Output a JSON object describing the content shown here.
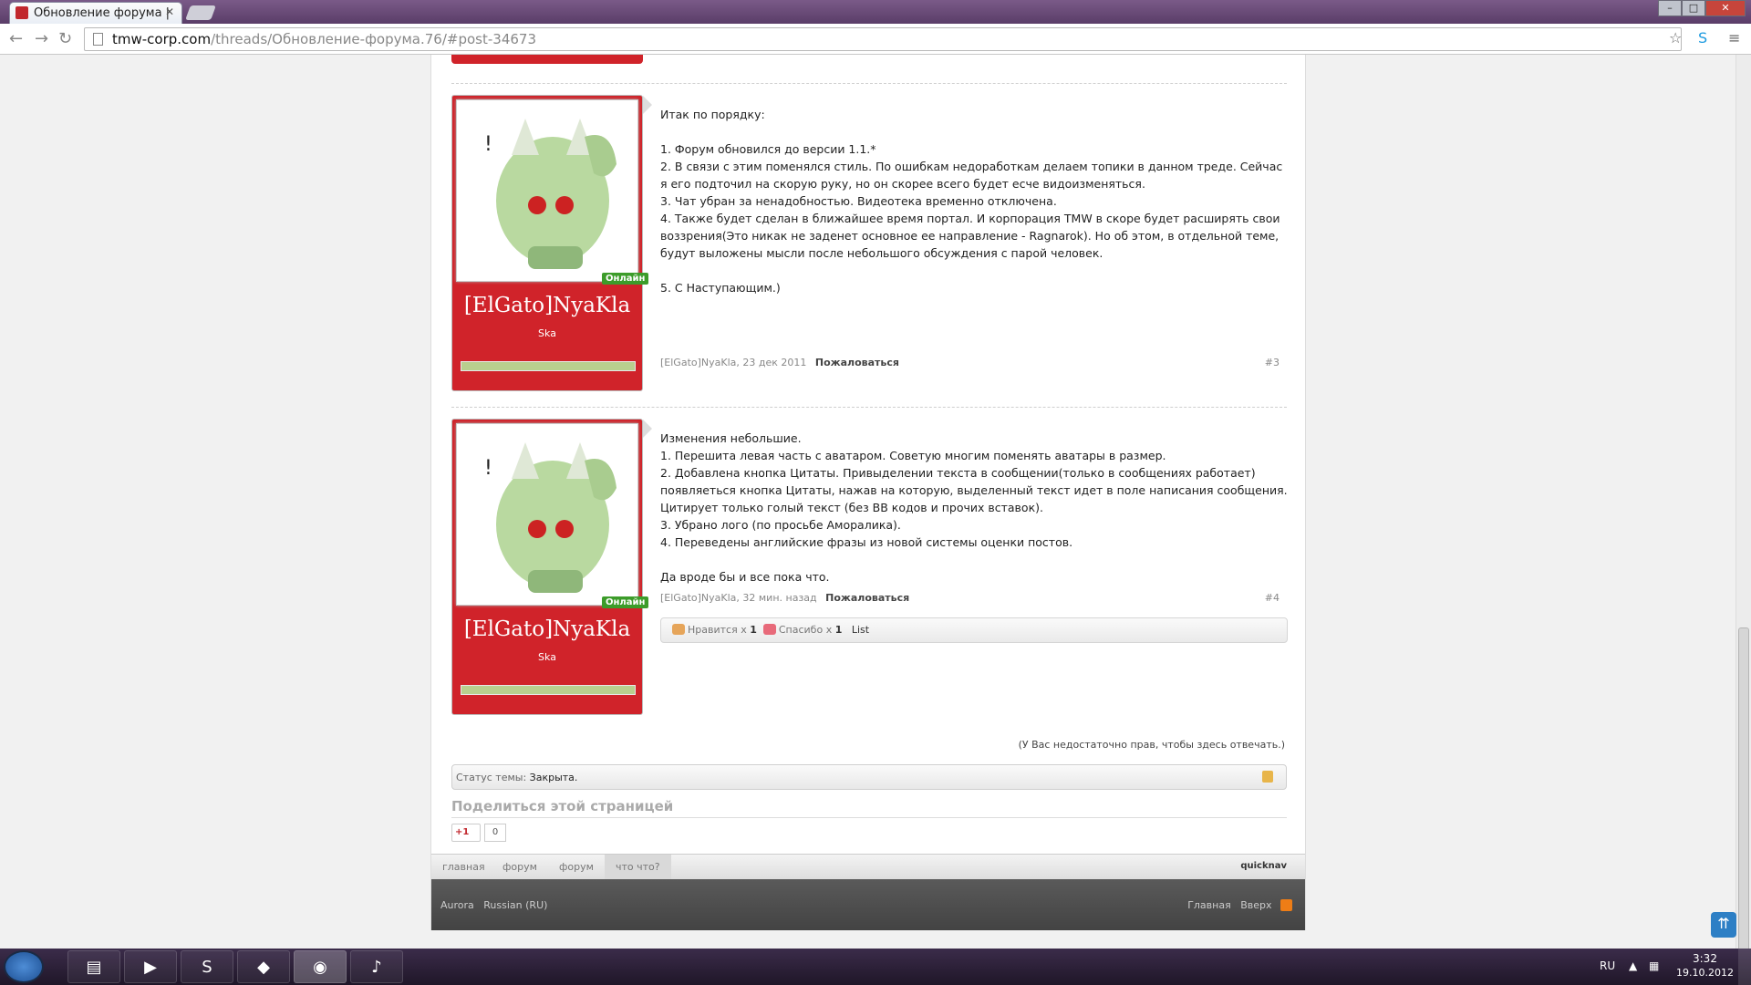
{
  "browser": {
    "tab_title": "Обновление форума |",
    "url_host": "tmw-corp.com",
    "url_path": "/threads/Обновление-форума.76/#post-34673"
  },
  "posts": [
    {
      "avatar_badge": "Онлайн",
      "username": "[ElGato]NyaKla",
      "user_title": "Ska",
      "message": "Итак по порядку:\n\n1. Форум обновился до версии 1.1.*\n2. В связи с этим поменялся стиль. По ошибкам недоработкам делаем топики в данном треде. Сейчас я его подточил на скорую руку, но он скорее всего будет есче видоизменяться.\n3. Чат убран за ненадобностью. Видеотека временно отключена.\n4. Также будет сделан в ближайшее время портал. И корпорация TMW в скоре будет расширять свои воззрения(Это никак не заденет основное ее направление - Ragnarok). Но об этом, в отдельной теме, будут выложены мысли после небольшого обсуждения с парой человек.\n\n5. С Наступающим.)",
      "meta": "[ElGato]NyaKla, 23 дек 2011",
      "report": "Пожаловаться",
      "number": "#3"
    },
    {
      "avatar_badge": "Онлайн",
      "username": "[ElGato]NyaKla",
      "user_title": "Ska",
      "message": "Изменения небольшие.\n1. Перешита левая часть с аватаром. Советую многим поменять аватары в размер.\n2. Добавлена кнопка Цитаты. Привыделении текста в сообщении(только в сообщениях работает) появляеться кнопка Цитаты, нажав на которую, выделенный текст идет в поле написания сообщения. Цитирует только голый текст (без BB кодов и прочих вставок).\n3. Убрано лого (по просьбе Аморалика).\n4. Переведены английские фразы из новой системы оценки постов.\n\nДа вроде бы и все пока что.",
      "meta": "[ElGato]NyaKla, 32 мин. назад",
      "report": "Пожаловаться",
      "number": "#4",
      "likes_label": "Нравится x",
      "likes_count": "1",
      "thanks_label": "Спасибо x",
      "thanks_count": "1",
      "list_label": "List"
    }
  ],
  "no_permission": "(У Вас недостаточно прав, чтобы здесь отвечать.)",
  "thread_status": {
    "label": "Статус темы:",
    "value": "Закрыта."
  },
  "share": {
    "title": "Поделиться этой страницей",
    "gplus": "+1",
    "count": "0"
  },
  "breadcrumbs": [
    "главная",
    "форум",
    "форум",
    "что что?"
  ],
  "quicknav": "quicknav",
  "footer": {
    "style": "Aurora",
    "language": "Russian (RU)",
    "home": "Главная",
    "top": "Вверх"
  },
  "taskbar": {
    "lang": "RU",
    "time": "3:32",
    "date": "19.10.2012"
  },
  "colors": {
    "accent_red": "#d0232a",
    "online_green": "#3c9c2a",
    "footer_bg": "#4a4a4a"
  }
}
